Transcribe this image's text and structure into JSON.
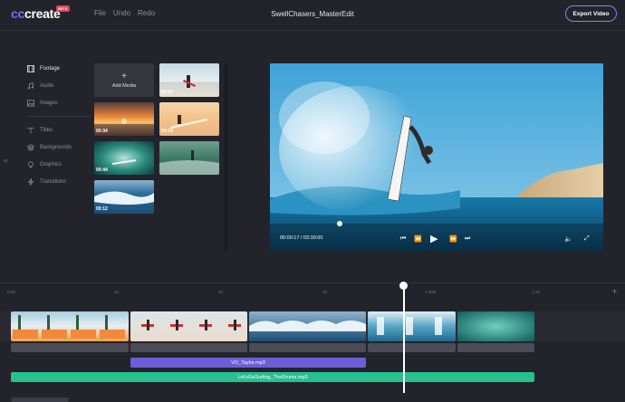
{
  "app": {
    "logo_cc": "cc",
    "logo_create": "create",
    "beta_badge": "BETA",
    "menu": [
      "File",
      "Undo",
      "Redo"
    ],
    "project_title": "SwellChasers_MasterEdit",
    "export_label": "Export Video"
  },
  "sidebar": {
    "items": [
      {
        "label": "Footage",
        "icon": "film-icon",
        "active": true
      },
      {
        "label": "Audio",
        "icon": "music-note-icon",
        "active": false
      },
      {
        "label": "Images",
        "icon": "image-icon",
        "active": false
      },
      {
        "label": "Titles",
        "icon": "text-icon",
        "active": false
      },
      {
        "label": "Backgrounds",
        "icon": "layers-icon",
        "active": false
      },
      {
        "label": "Graphics",
        "icon": "pin-icon",
        "active": false
      },
      {
        "label": "Transitions",
        "icon": "bolt-icon",
        "active": false
      }
    ],
    "collapse_glyph": "«"
  },
  "media": {
    "add_plus": "+",
    "add_label": "Add Media",
    "thumbs": [
      {
        "duration": "00:15",
        "scene": "beach-walk"
      },
      {
        "duration": "00:34",
        "scene": "sunset"
      },
      {
        "duration": "00:23",
        "scene": "sand-board"
      },
      {
        "duration": "00:44",
        "scene": "tube-ride"
      },
      {
        "duration": "",
        "scene": "green-surfer"
      },
      {
        "duration": "00:12",
        "scene": "wave-break"
      }
    ]
  },
  "preview": {
    "time": "00:00:17 / 03:30:00",
    "controls": [
      "skip-back-icon",
      "rewind-icon",
      "play-icon",
      "fast-forward-icon",
      "skip-forward-icon",
      "volume-icon",
      "fullscreen-icon"
    ],
    "progress": 0.21
  },
  "timeline": {
    "ticks": [
      "0:00",
      "15",
      "30",
      "45",
      "1 MIN",
      "1:15"
    ],
    "plus": "+",
    "video_clips": [
      "beach-walk",
      "beach-walk-2",
      "wave-break",
      "green-surfer",
      "tube-ride"
    ],
    "voiceover": "VO_Taylor.mp3",
    "music": "Let'sGoSurfing_TheDrums.mp3",
    "colors": {
      "voiceover": "#6a5fd8",
      "music": "#27c08f",
      "accent": "#7b6cf6"
    }
  }
}
